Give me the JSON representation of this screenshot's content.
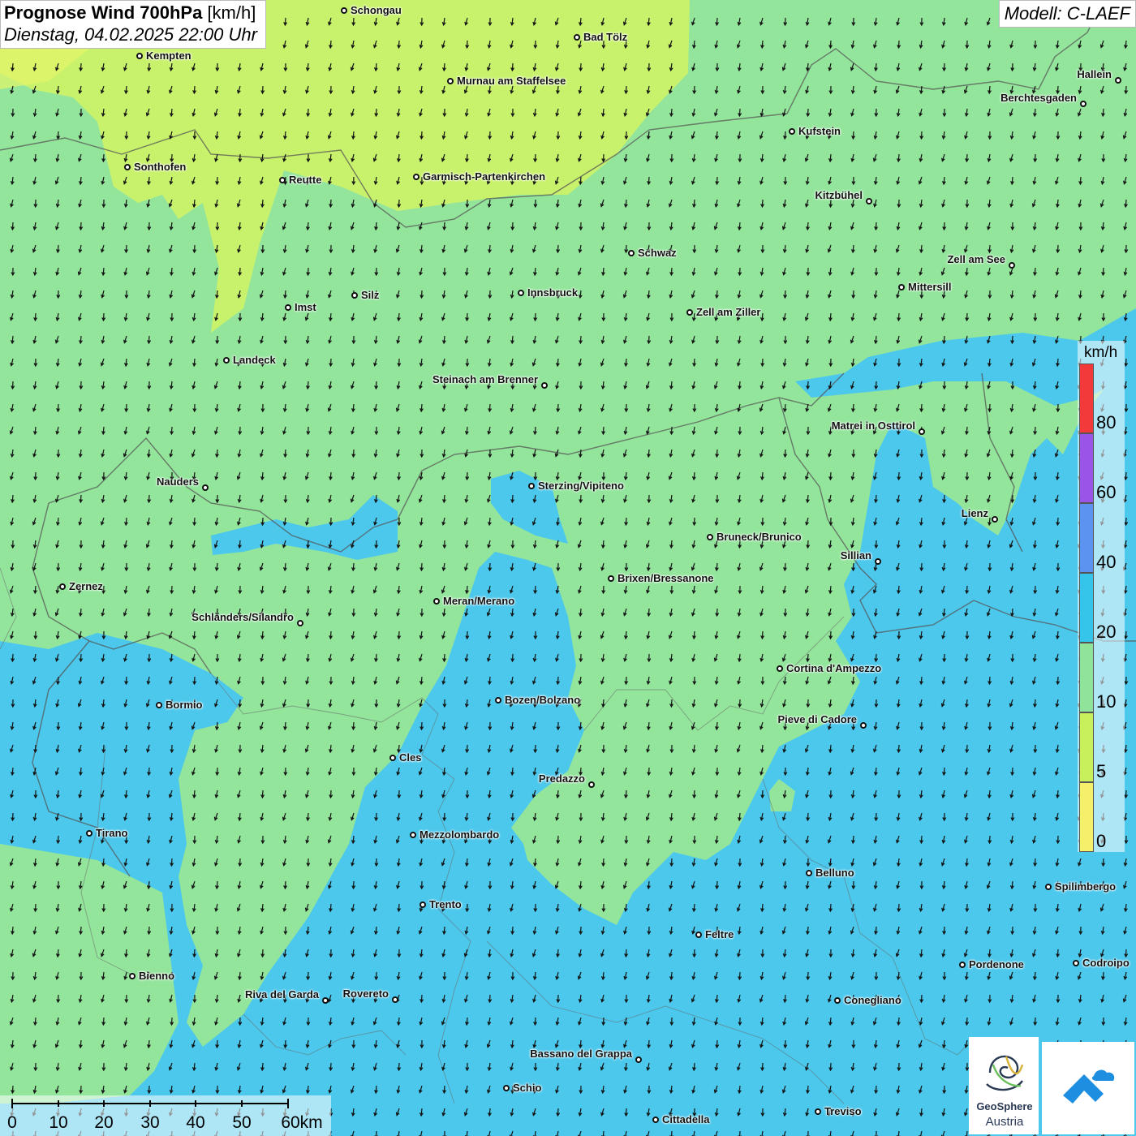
{
  "header": {
    "title_bold": "Prognose Wind 700hPa",
    "title_unit": "[km/h]",
    "datetime": "Dienstag, 04.02.2025 22:00 Uhr",
    "model": "Modell: C-LAEF"
  },
  "legend": {
    "unit": "km/h",
    "ticks": [
      "80",
      "60",
      "40",
      "20",
      "10",
      "5",
      "0"
    ],
    "colors": [
      "#f23a3a",
      "#9a55e8",
      "#5c92f0",
      "#35c4ea",
      "#8fe49a",
      "#c8f05a",
      "#f5f06a"
    ]
  },
  "scalebar": {
    "labels": [
      "0",
      "10",
      "20",
      "30",
      "40",
      "50",
      "60km"
    ]
  },
  "logo": {
    "name_line1": "GeoSphere",
    "name_line2": "Austria"
  },
  "cities": [
    {
      "name": "Schongau"
    },
    {
      "name": "Bad Tölz"
    },
    {
      "name": "Kempten"
    },
    {
      "name": "Murnau am Staffelsee"
    },
    {
      "name": "Hallein"
    },
    {
      "name": "Berchtesgaden"
    },
    {
      "name": "Kufstein"
    },
    {
      "name": "Sonthofen"
    },
    {
      "name": "Reutte"
    },
    {
      "name": "Garmisch-Partenkirchen"
    },
    {
      "name": "Kitzbühel"
    },
    {
      "name": "Schwaz"
    },
    {
      "name": "Zell am See"
    },
    {
      "name": "Mittersill"
    },
    {
      "name": "Innsbruck"
    },
    {
      "name": "Silz"
    },
    {
      "name": "Imst"
    },
    {
      "name": "Zell am Ziller"
    },
    {
      "name": "Landeck"
    },
    {
      "name": "Steinach am Brenner"
    },
    {
      "name": "Matrei in Osttirol"
    },
    {
      "name": "Nauders"
    },
    {
      "name": "Sterzing/Vipiteno"
    },
    {
      "name": "Lienz"
    },
    {
      "name": "Bruneck/Brunico"
    },
    {
      "name": "Sillian"
    },
    {
      "name": "Zernez"
    },
    {
      "name": "Brixen/Bressanone"
    },
    {
      "name": "Meran/Merano"
    },
    {
      "name": "Schlanders/Silandro"
    },
    {
      "name": "Cortina d'Ampezzo"
    },
    {
      "name": "Bozen/Bolzano"
    },
    {
      "name": "Bormio"
    },
    {
      "name": "Pieve di Cadore"
    },
    {
      "name": "Cles"
    },
    {
      "name": "Predazzo"
    },
    {
      "name": "Tirano"
    },
    {
      "name": "Mezzolombardo"
    },
    {
      "name": "Belluno"
    },
    {
      "name": "Spilimbergo"
    },
    {
      "name": "Trento"
    },
    {
      "name": "Feltre"
    },
    {
      "name": "Pordenone"
    },
    {
      "name": "Codroipo"
    },
    {
      "name": "Bienno"
    },
    {
      "name": "Riva del Garda"
    },
    {
      "name": "Rovereto"
    },
    {
      "name": "Conegliano"
    },
    {
      "name": "Bassano del Grappa"
    },
    {
      "name": "Schio"
    },
    {
      "name": "Treviso"
    },
    {
      "name": "Cittadella"
    }
  ]
}
